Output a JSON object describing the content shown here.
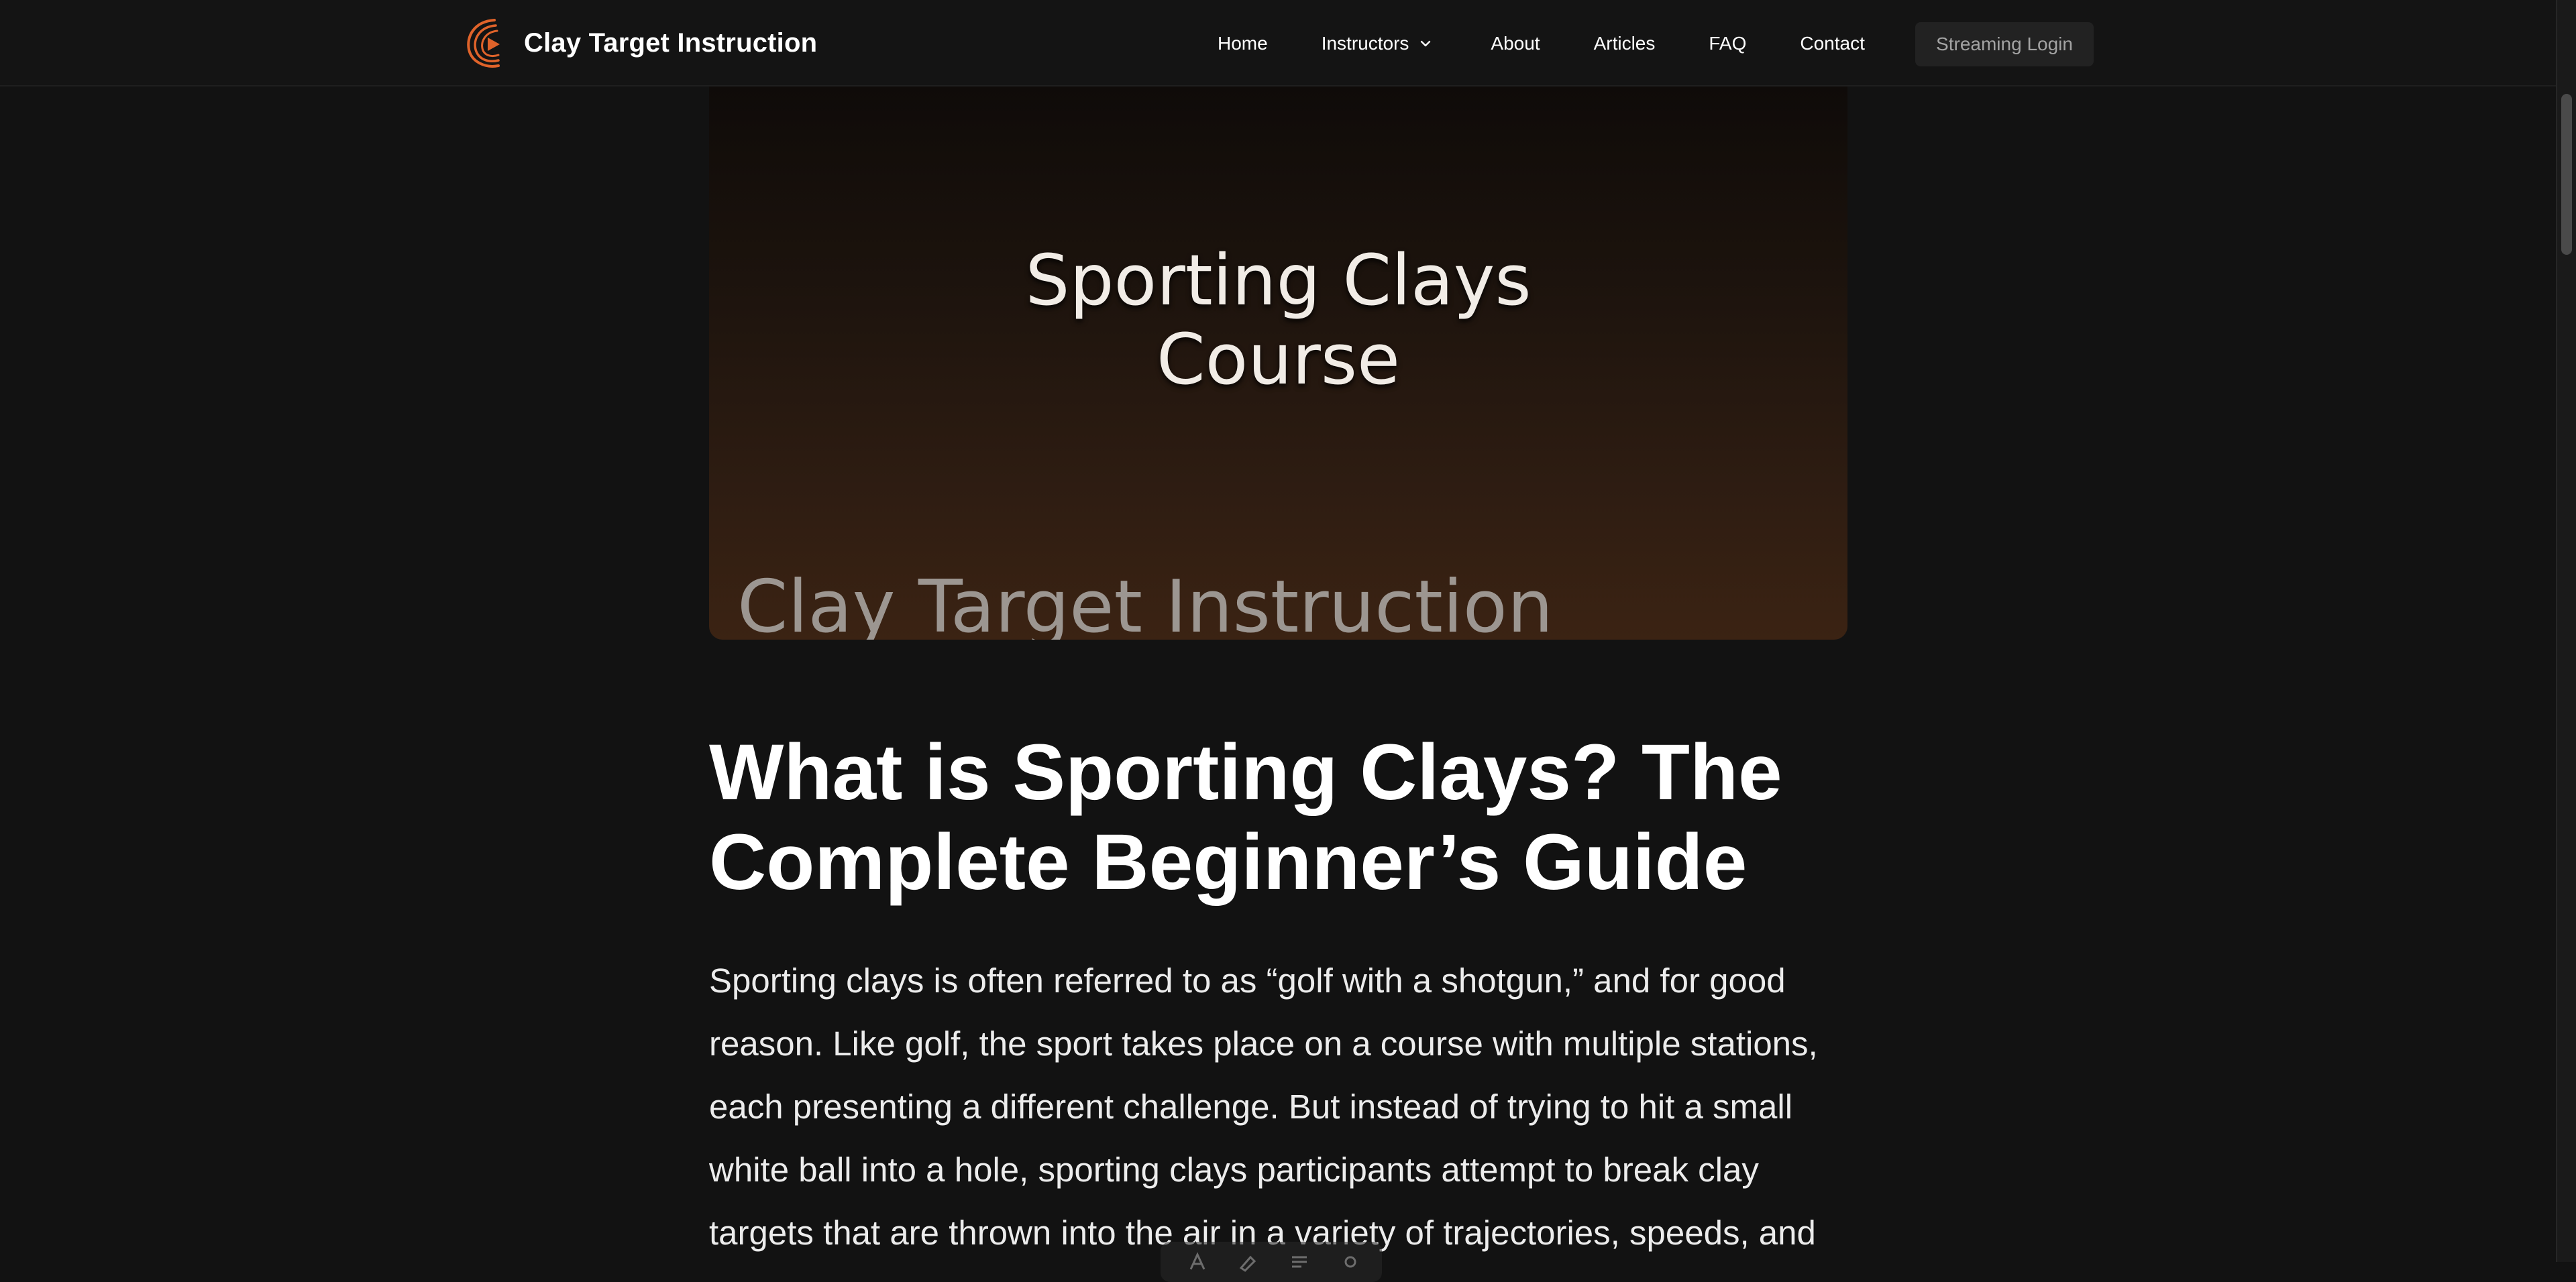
{
  "header": {
    "brand_name": "Clay Target Instruction",
    "nav": [
      {
        "label": "Home"
      },
      {
        "label": "Instructors",
        "has_dropdown": true
      },
      {
        "label": "About"
      },
      {
        "label": "Articles"
      },
      {
        "label": "FAQ"
      },
      {
        "label": "Contact"
      }
    ],
    "login_label": "Streaming Login"
  },
  "hero": {
    "title": "Sporting Clays\nCourse",
    "watermark": "Clay Target Instruction"
  },
  "article": {
    "title": "What is Sporting Clays? The Complete Beginner’s Guide",
    "intro": "Sporting clays is often referred to as “golf with a shotgun,” and for good reason. Like golf, the sport takes place on a course with multiple stations, each presenting a different challenge. But instead of trying to hit a small white ball into a hole, sporting clays participants attempt to break clay targets that are thrown into the air in a variety of trajectories, speeds, and"
  },
  "colors": {
    "background": "#121212",
    "brand_accent": "#e0632a",
    "login_bg": "#222222",
    "login_text": "#a3a3a3"
  },
  "icons": {
    "logo": "play-swoosh-logo-icon",
    "dropdown": "chevron-down-icon"
  }
}
